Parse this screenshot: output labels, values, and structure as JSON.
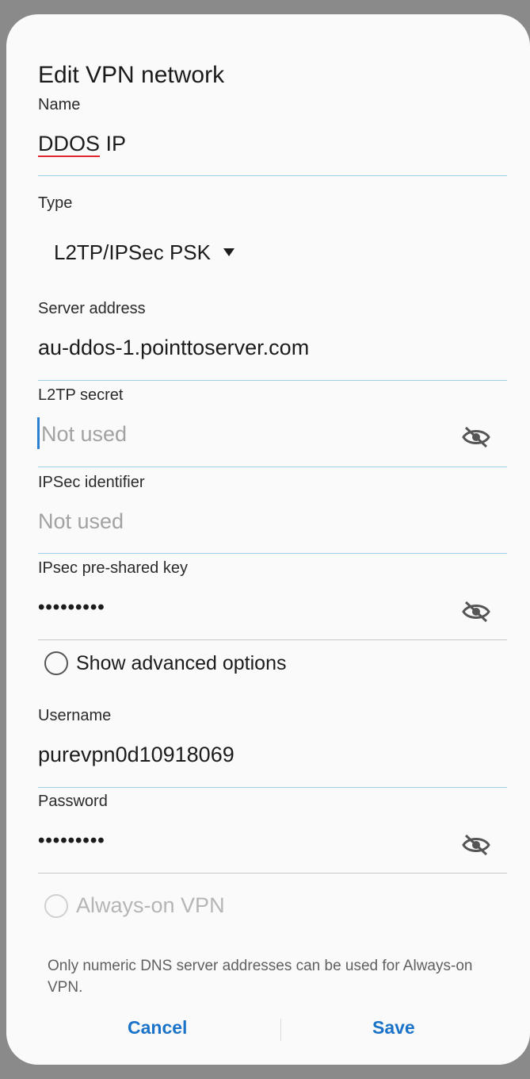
{
  "dialog": {
    "title": "Edit VPN network",
    "name": {
      "label": "Name",
      "value_spell": "DDOS",
      "value_rest": " IP"
    },
    "type": {
      "label": "Type",
      "selected": "L2TP/IPSec PSK"
    },
    "server_address": {
      "label": "Server address",
      "value": "au-ddos-1.pointtoserver.com"
    },
    "l2tp_secret": {
      "label": "L2TP secret",
      "placeholder": "Not used"
    },
    "ipsec_identifier": {
      "label": "IPSec identifier",
      "placeholder": "Not used"
    },
    "ipsec_psk": {
      "label": "IPsec pre-shared key",
      "value": "•••••••••"
    },
    "show_advanced": {
      "label": "Show advanced options",
      "checked": false
    },
    "username": {
      "label": "Username",
      "value": "purevpn0d10918069"
    },
    "password": {
      "label": "Password",
      "value": "•••••••••"
    },
    "always_on": {
      "label": "Always-on VPN",
      "enabled": false
    },
    "note": "Only numeric DNS server addresses can be used for Always-on VPN.",
    "buttons": {
      "cancel": "Cancel",
      "save": "Save"
    }
  },
  "icons": {
    "visibility_toggle": "eye-off-icon",
    "dropdown": "dropdown-arrow-icon"
  },
  "colors": {
    "accent": "#1a73c8",
    "active_underline": "#9ecfe6",
    "spell_error": "#e0252e"
  }
}
